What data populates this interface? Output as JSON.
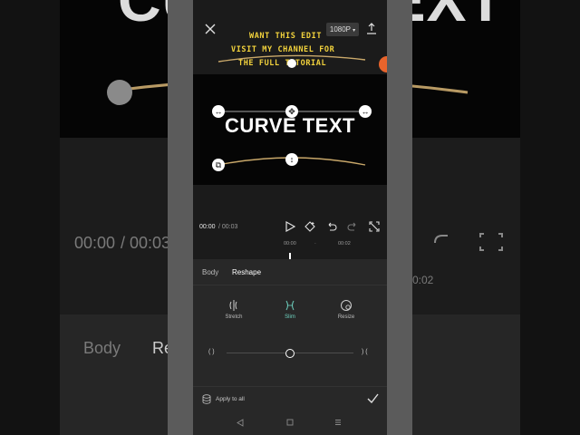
{
  "background": {
    "title": "CURVE TEXT",
    "time_current": "00:00",
    "time_total": "/ 00:03",
    "tab_body": "Body",
    "tab_reshape_partial": "Re",
    "tick_partial": "0:02"
  },
  "header": {
    "close_icon": "close-icon",
    "resolution": "1080P",
    "export_icon": "upload-icon"
  },
  "promo": {
    "line1": "WANT THIS EDIT",
    "line2": "VISIT MY CHANNEL FOR",
    "line3": "THE FULL TUTORIAL"
  },
  "preview": {
    "text": "CURVE TEXT"
  },
  "playback": {
    "time_current": "00:00",
    "time_total": "/ 00:03",
    "ticks": [
      "00:00",
      "00:02"
    ]
  },
  "panel": {
    "tabs": [
      {
        "label": "Body",
        "active": false
      },
      {
        "label": "Reshape",
        "active": true
      }
    ],
    "options": [
      {
        "label": "Stretch",
        "icon": "stretch-icon",
        "active": false
      },
      {
        "label": "Slim",
        "icon": "slim-icon",
        "active": true
      },
      {
        "label": "Resize",
        "icon": "resize-icon",
        "active": false
      }
    ],
    "slider_left": "( )",
    "slider_right": ") (",
    "slider_value": 0.5,
    "apply_all": "Apply to all"
  },
  "colors": {
    "accent": "#6fd3c1",
    "promo_text": "#f2d23c",
    "curve_line": "#c9a86a"
  }
}
